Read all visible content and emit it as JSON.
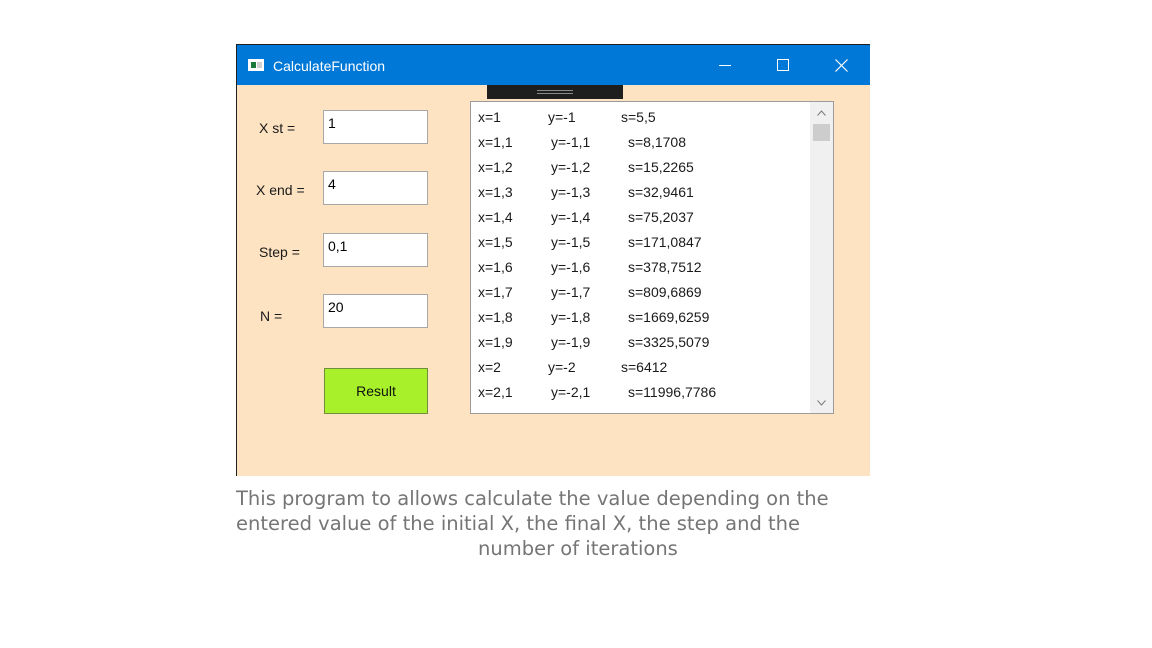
{
  "window": {
    "title": "CalculateFunction"
  },
  "form": {
    "xstart_label": "X st =",
    "xstart_value": "1",
    "xend_label": "X end =",
    "xend_value": "4",
    "step_label": "Step =",
    "step_value": "0,1",
    "n_label": "N =",
    "n_value": "20",
    "result_button": "Result"
  },
  "results": [
    {
      "x": "x=1",
      "y": "y=-1",
      "s": "s=5,5"
    },
    {
      "x": "x=1,1",
      "y": "y=-1,1",
      "s": "s=8,1708"
    },
    {
      "x": "x=1,2",
      "y": "y=-1,2",
      "s": "s=15,2265"
    },
    {
      "x": "x=1,3",
      "y": "y=-1,3",
      "s": "s=32,9461"
    },
    {
      "x": "x=1,4",
      "y": "y=-1,4",
      "s": "s=75,2037"
    },
    {
      "x": "x=1,5",
      "y": "y=-1,5",
      "s": "s=171,0847"
    },
    {
      "x": "x=1,6",
      "y": "y=-1,6",
      "s": "s=378,7512"
    },
    {
      "x": "x=1,7",
      "y": "y=-1,7",
      "s": "s=809,6869"
    },
    {
      "x": "x=1,8",
      "y": "y=-1,8",
      "s": "s=1669,6259"
    },
    {
      "x": "x=1,9",
      "y": "y=-1,9",
      "s": "s=3325,5079"
    },
    {
      "x": "x=2",
      "y": "y=-2",
      "s": "s=6412"
    },
    {
      "x": "x=2,1",
      "y": "y=-2,1",
      "s": "s=11996,7786"
    }
  ],
  "caption": {
    "line1": "This program to allows calculate the value depending on the",
    "line2": "entered value of the initial X, the final X, the step and the",
    "line3": "number of iterations"
  },
  "icons": {
    "minimize": "minimize-icon",
    "maximize": "maximize-icon",
    "close": "close-icon",
    "scroll_up": "chevron-up-icon",
    "scroll_down": "chevron-down-icon"
  },
  "colors": {
    "titlebar": "#0078d7",
    "form_background": "#fde3c2",
    "result_button": "#a7f02a",
    "caption_text": "#757575"
  }
}
